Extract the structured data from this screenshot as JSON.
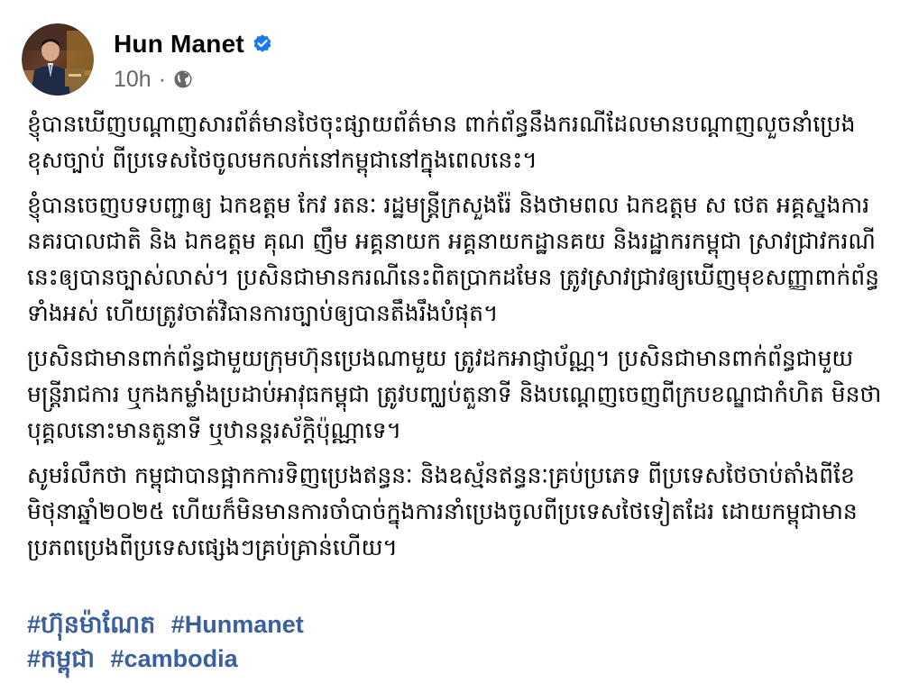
{
  "post": {
    "author_name": "Hun Manet",
    "verified_icon": "verified-badge-icon",
    "timestamp": "10h",
    "separator": "·",
    "audience_icon": "globe-icon",
    "paragraphs": [
      "ខ្ញុំបានឃើញបណ្ដាញសារព័ត៌មានថៃចុះផ្សាយព័ត៌មាន ពាក់ព័ន្ធនឹងករណីដែលមានបណ្ដាញលួចនាំប្រេងខុសច្បាប់ ពីប្រទេសថៃចូលមកលក់នៅកម្ពុជានៅក្នុងពេលនេះ។",
      "ខ្ញុំបានចេញបទបញ្ជាឲ្យ ឯកឧត្តម កែវ រតនៈ រដ្ឋមន្ត្រីក្រសួងរ៉ែ និងថាមពល ឯកឧត្តម ស ថេត អគ្គស្នងការនគរបាលជាតិ និង ឯកឧត្តម គុណ ញឹម អគ្គនាយក អគ្គនាយកដ្ឋានគយ និងរដ្ឋាករកម្ពុជា ស្រាវជ្រាវករណីនេះឲ្យបានច្បាស់លាស់។ ប្រសិនជាមានករណីនេះពិតប្រាកដមែន ត្រូវស្រាវជ្រាវឲ្យឃើញមុខសញ្ញាពាក់ព័ន្ធទាំងអស់ ហើយត្រូវចាត់វិធានការច្បាប់ឲ្យបានតឹងរឹងបំផុត។",
      "ប្រសិនជាមានពាក់ព័ន្ធជាមួយក្រុមហ៊ុនប្រេងណាមួយ ត្រូវដកអាជ្ញាប័ណ្ណ។ ប្រសិនជាមានពាក់ព័ន្ធជាមួយមន្ត្រីរាជការ ឬកងកម្លាំងប្រដាប់អាវុធកម្ពុជា ត្រូវបញ្ឈប់តួនាទី និងបណ្ដេញចេញពីក្របខណ្ឌជាកំហិត មិនថាបុគ្គលនោះមានតួនាទី ឬឋានន្តរស័ក្តិប៉ុណ្ណាទេ។",
      "សូមរំលឹកថា កម្ពុជាបានផ្អាកការទិញប្រេងឥន្ធនៈ និងឧស្ម័នឥន្ធនៈគ្រប់ប្រភេទ ពីប្រទេសថៃចាប់តាំងពីខែមិថុនាឆ្នាំ២០២៥ ហើយក៏មិនមានការចាំបាច់ក្នុងការនាំប្រេងចូលពីប្រទេសថៃទៀតដែរ ដោយកម្ពុជាមានប្រភពប្រេងពីប្រទេសផ្សេងៗគ្រប់គ្រាន់ហើយ។"
    ],
    "hashtags": [
      [
        "#ហ៊ុនម៉ាណែត",
        "#Hunmanet"
      ],
      [
        "#កម្ពុជា",
        "#cambodia"
      ]
    ]
  },
  "colors": {
    "link": "#385898",
    "verified": "#1877f2",
    "secondary_text": "#65676b"
  }
}
